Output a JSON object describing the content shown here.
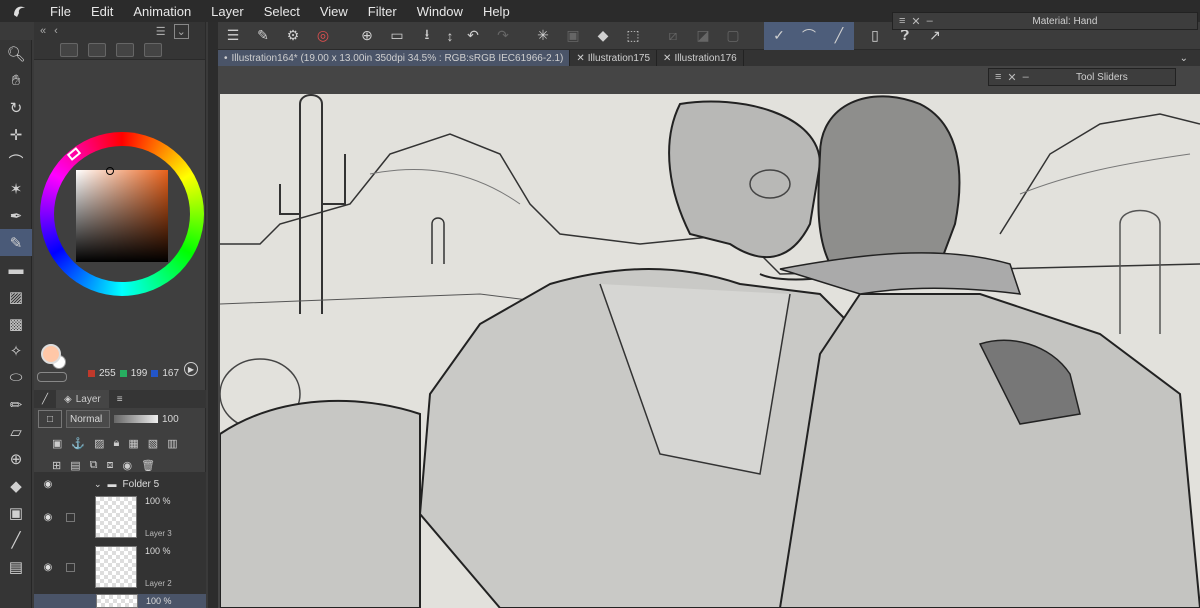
{
  "menubar": {
    "items": [
      "File",
      "Edit",
      "Animation",
      "Layer",
      "Select",
      "View",
      "Filter",
      "Window",
      "Help"
    ]
  },
  "floating": {
    "material_title": "Material: Hand",
    "sliders_title": "Tool Sliders"
  },
  "color": {
    "r": "255",
    "g": "199",
    "b": "167",
    "main_hex": "#ffc7a7",
    "sub_hex": "#ffffff",
    "r_box": "#c0392b",
    "g_box": "#27ae60",
    "b_box": "#2355c7"
  },
  "layer_panel": {
    "tab_label": "Layer",
    "blend_mode": "Normal",
    "opacity": "100",
    "rows": [
      {
        "name": "Folder 5",
        "opacity": "",
        "kind": "folder"
      },
      {
        "name": "Layer 3",
        "opacity": "100 %",
        "kind": "layer"
      },
      {
        "name": "Layer 2",
        "opacity": "100 %",
        "kind": "layer"
      },
      {
        "name": "",
        "opacity": "100 %",
        "kind": "layer"
      }
    ]
  },
  "tabs": [
    {
      "label": "Illustration164* (19.00 x 13.00in 350dpi 34.5% : RGB:sRGB IEC61966-2.1)",
      "active": true
    },
    {
      "label": "Illustration175",
      "active": false
    },
    {
      "label": "Illustration176",
      "active": false
    }
  ],
  "tool_icons": [
    "zoom-icon",
    "hand-icon",
    "rotate-icon",
    "move-icon",
    "lasso-icon",
    "magic-wand-icon",
    "eyedropper-icon",
    "pen-icon",
    "eraser-icon",
    "fill-icon",
    "gradient-icon",
    "blend-icon",
    "figure-icon",
    "frame-icon",
    "ruler-icon",
    "text-icon",
    "balloon-icon",
    "line-icon",
    "correction-icon"
  ]
}
